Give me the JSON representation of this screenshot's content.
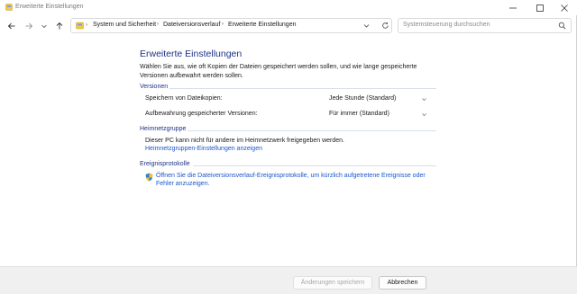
{
  "window": {
    "title": "Erweiterte Einstellungen"
  },
  "nav": {
    "breadcrumbs": [
      "System und Sicherheit",
      "Dateiversionsverlauf",
      "Erweiterte Einstellungen"
    ],
    "search_placeholder": "Systemsteuerung durchsuchen"
  },
  "page": {
    "title": "Erweiterte Einstellungen",
    "intro": "Wählen Sie aus, wie oft Kopien der Dateien gespeichert werden sollen, und wie lange gespeicherte Versionen aufbewahrt werden sollen."
  },
  "versions": {
    "heading": "Versionen",
    "save_label": "Speichern von Dateikopien:",
    "save_value": "Jede Stunde (Standard)",
    "keep_label": "Aufbewahrung gespeicherter Versionen:",
    "keep_value": "Für immer (Standard)"
  },
  "homegroup": {
    "heading": "Heimnetzgruppe",
    "text": "Dieser PC kann nicht für andere im Heimnetzwerk freigegeben werden.",
    "link": "Heimnetzgruppen-Einstellungen anzeigen"
  },
  "events": {
    "heading": "Ereignisprotokolle",
    "link_line1": "Öffnen Sie die Dateiversionsverlauf-Ereignisprotokolle, um kürzlich aufgetretene Ereignisse oder",
    "link_line2": "Fehler anzuzeigen."
  },
  "footer": {
    "save_button": "Änderungen speichern",
    "cancel_button": "Abbrechen"
  },
  "icons": {
    "app": "control-panel-icon",
    "shield": "uac-shield-icon"
  },
  "colors": {
    "heading_blue": "#1e3287",
    "link_blue": "#1a56c9",
    "footer_bg": "#f0f0f0"
  }
}
